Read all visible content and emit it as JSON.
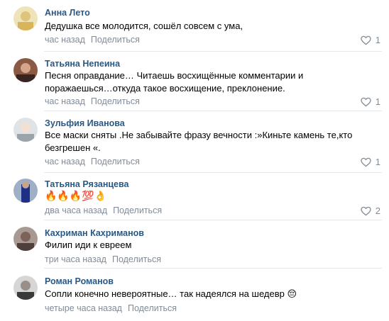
{
  "comments": [
    {
      "author": "Анна Лето",
      "text": "Дедушка все молодится, сошёл совсем с ума,",
      "time": "час назад",
      "share": "Поделиться",
      "likes": "1",
      "avatar_color": "#e9d9a8"
    },
    {
      "author": "Татьяна Непеина",
      "text": "Песня оправдание… Читаешь восхищённые комментарии и поражаешься…откуда такое восхищение, преклонение.",
      "time": "час назад",
      "share": "Поделиться",
      "likes": "1",
      "avatar_color": "#6b3c2f"
    },
    {
      "author": "Зульфия Иванова",
      "text": "Все маски сняты .Не забывайте фразу вечности :»Киньте камень те,кто безгрешен «.",
      "time": "час назад",
      "share": "Поделиться",
      "likes": "1",
      "avatar_color": "#c9cfd3"
    },
    {
      "author": "Татьяна Рязанцева",
      "text": "🔥🔥🔥💯👌",
      "time": "два часа назад",
      "share": "Поделиться",
      "likes": "2",
      "avatar_color": "#2b3a7a"
    },
    {
      "author": "Кахриман Кахриманов",
      "text": "Филип иди к евреем",
      "time": "три часа назад",
      "share": "Поделиться",
      "likes": "",
      "avatar_color": "#8c7a72"
    },
    {
      "author": "Роман Романов",
      "text": "Сопли конечно невероятные… так надеялся на шедевр 😔",
      "time": "четыре часа назад",
      "share": "Поделиться",
      "likes": "",
      "avatar_color": "#b7b7b7"
    }
  ]
}
